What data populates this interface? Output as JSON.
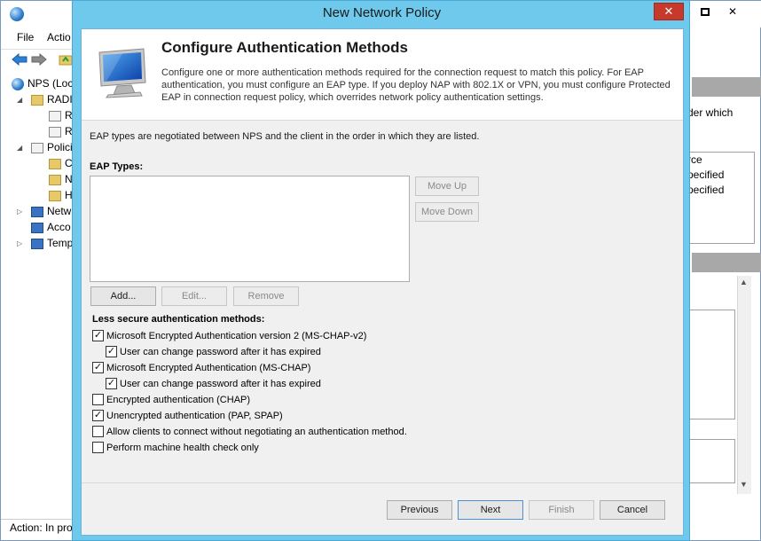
{
  "background": {
    "menu": [
      "File",
      "Actio"
    ],
    "tree": [
      {
        "label": "NPS (Loc",
        "icon": "globe-icon"
      },
      {
        "label": "RADIU",
        "icon": "folder-icon"
      },
      {
        "label": "RA",
        "icon": "document-icon"
      },
      {
        "label": "Re",
        "icon": "document-icon"
      },
      {
        "label": "Polici",
        "icon": "document-icon"
      },
      {
        "label": "C",
        "icon": "folder-icon"
      },
      {
        "label": "N",
        "icon": "folder-icon"
      },
      {
        "label": "H",
        "icon": "folder-icon"
      },
      {
        "label": "Netw",
        "icon": "network-icon"
      },
      {
        "label": "Acco",
        "icon": "network-icon"
      },
      {
        "label": "Temp",
        "icon": "network-icon"
      }
    ],
    "status": "Action:  In pro",
    "right_strip": {
      "line1": "der which",
      "col_header": "rce",
      "row1": "pecified",
      "row2": "pecified"
    }
  },
  "dialog": {
    "title": "New Network Policy",
    "header_title": "Configure Authentication Methods",
    "header_desc": "Configure one or more authentication methods required for the connection request to match this policy. For EAP authentication, you must configure an EAP type. If you deploy NAP with 802.1X or VPN, you must configure Protected EAP in connection request policy, which overrides network policy authentication settings.",
    "intro": "EAP types are negotiated between NPS and the client in the order in which they are listed.",
    "eap_label": "EAP Types:",
    "buttons": {
      "move_up": "Move Up",
      "move_down": "Move Down",
      "add": "Add...",
      "edit": "Edit...",
      "remove": "Remove",
      "previous": "Previous",
      "next": "Next",
      "finish": "Finish",
      "cancel": "Cancel"
    },
    "less_secure_label": "Less secure authentication methods:",
    "checkboxes": [
      {
        "label": "Microsoft Encrypted Authentication version 2 (MS-CHAP-v2)",
        "checked": true
      },
      {
        "label": "User can change password after it has expired",
        "checked": true
      },
      {
        "label": "Microsoft Encrypted Authentication (MS-CHAP)",
        "checked": true
      },
      {
        "label": "User can change password after it has expired",
        "checked": true
      },
      {
        "label": "Encrypted authentication (CHAP)",
        "checked": false
      },
      {
        "label": "Unencrypted authentication (PAP, SPAP)",
        "checked": true
      },
      {
        "label": "Allow clients to connect without negotiating an authentication method.",
        "checked": false
      },
      {
        "label": "Perform machine health check only",
        "checked": false
      }
    ]
  }
}
